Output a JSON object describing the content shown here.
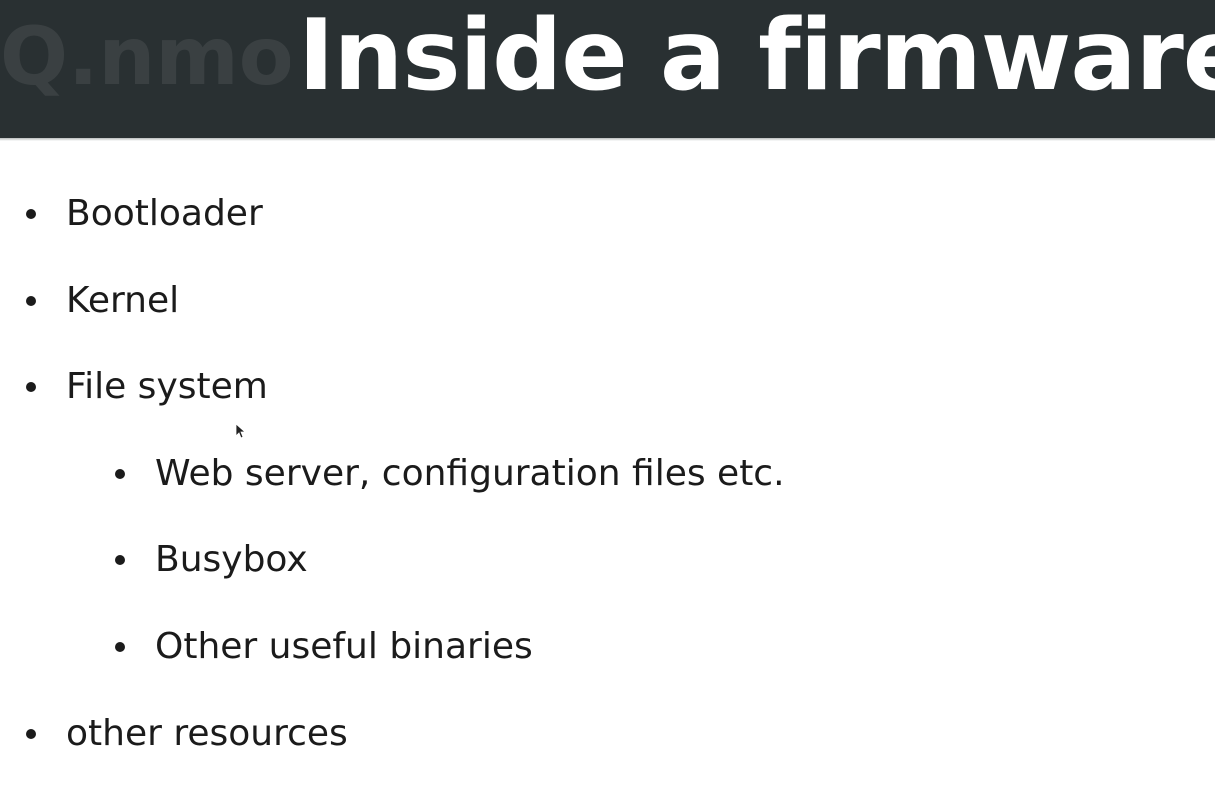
{
  "slide": {
    "title": "Inside a firmware",
    "header_ghost_text": "Q.nmo S",
    "colors": {
      "header_background": "#293032",
      "title_text": "#ffffff",
      "body_text": "#1b1b1b",
      "background": "#ffffff"
    },
    "bullets": [
      {
        "text": "Bootloader",
        "level": 1
      },
      {
        "text": "Kernel",
        "level": 1
      },
      {
        "text": "File system",
        "level": 1
      },
      {
        "text": "Web server, configuration files etc.",
        "level": 2
      },
      {
        "text": "Busybox",
        "level": 2
      },
      {
        "text": "Other useful binaries",
        "level": 2
      },
      {
        "text": "other resources",
        "level": 1
      }
    ],
    "cursor_icon": "mouse-pointer-icon"
  }
}
